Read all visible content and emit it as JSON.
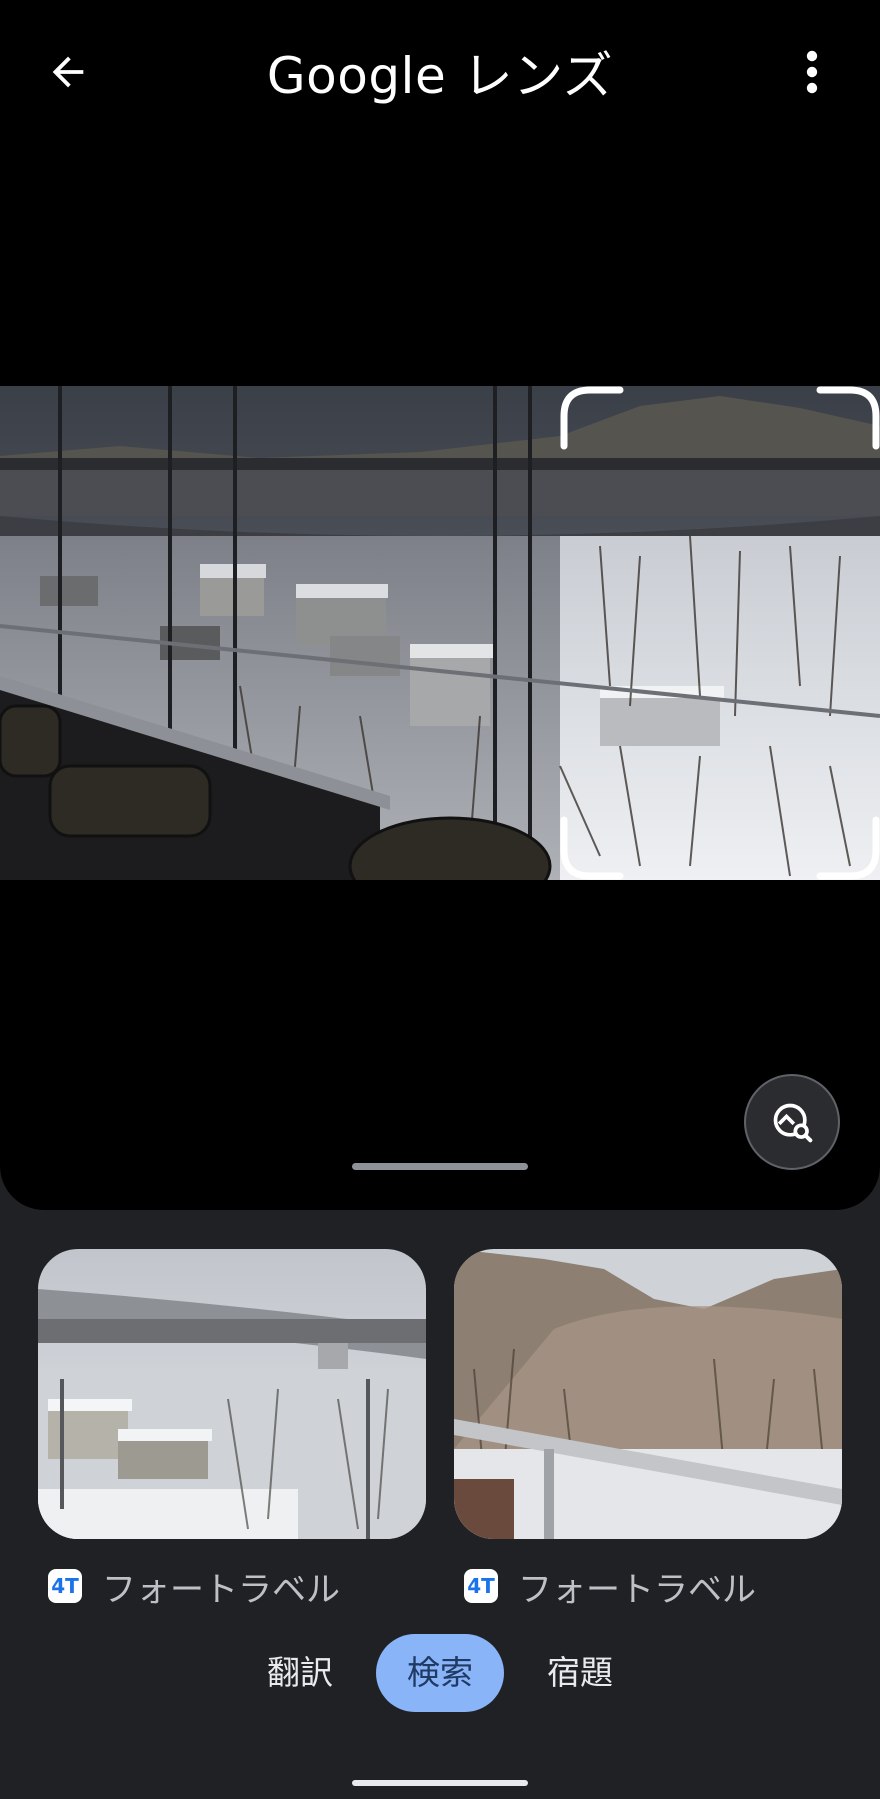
{
  "header": {
    "title": "Google レンズ",
    "back_icon": "arrow-back-icon",
    "menu_icon": "more-vert-icon"
  },
  "image": {
    "description_icon": "photo",
    "selection_icon": "crop-frame-icon"
  },
  "lens_search_icon": "image-search-icon",
  "results": [
    {
      "source": "フォートラベル",
      "source_icon_text": "4T"
    },
    {
      "source": "フォートラベル",
      "source_icon_text": "4T"
    }
  ],
  "modes": [
    {
      "label": "翻訳",
      "active": false
    },
    {
      "label": "検索",
      "active": true
    },
    {
      "label": "宿題",
      "active": false
    }
  ],
  "colors": {
    "background": "#202124",
    "viewer": "#000000",
    "active_tab": "#8ab4f8"
  }
}
